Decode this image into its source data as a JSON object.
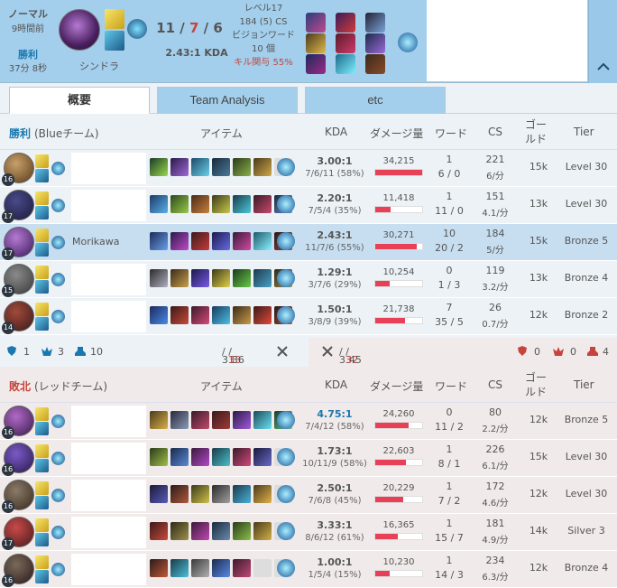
{
  "header": {
    "mode": "ノーマル",
    "time_ago": "9時間前",
    "result": "勝利",
    "length": "37分 8秒",
    "champion": "シンドラ",
    "kills": "11",
    "deaths": "7",
    "assists": "6",
    "sep": "/",
    "kda_ratio": "2.43:1 KDA",
    "level": "レベル17",
    "cs": "184 (5) CS",
    "vision_label": "ビジョンワード",
    "vision_count": "10 個",
    "kill_participation": "キル関与 55%"
  },
  "tabs": [
    {
      "label": "概要"
    },
    {
      "label": "Team Analysis"
    },
    {
      "label": "etc"
    }
  ],
  "columns": {
    "items": "アイテム",
    "kda": "KDA",
    "damage": "ダメージ量",
    "ward": "ワード",
    "cs": "CS",
    "gold": "ゴールド",
    "tier": "Tier"
  },
  "blue": {
    "result": "勝利",
    "team": "(Blueチーム)",
    "players": [
      {
        "lvl": "16",
        "name": "",
        "kda": "3.00:1",
        "kdaf": "7/6/11 (58%)",
        "dmg": "34,215",
        "dmgp": 1.0,
        "w1": "1",
        "w2": "6 / 0",
        "cs1": "221",
        "cs2": "6/分",
        "gold": "15k",
        "tier": "Level 30"
      },
      {
        "lvl": "17",
        "name": "",
        "kda": "2.20:1",
        "kdaf": "7/5/4 (35%)",
        "dmg": "11,418",
        "dmgp": 0.33,
        "w1": "1",
        "w2": "11 / 0",
        "cs1": "151",
        "cs2": "4.1/分",
        "gold": "13k",
        "tier": "Level 30"
      },
      {
        "lvl": "17",
        "name": "Morikawa",
        "kda": "2.43:1",
        "kdaf": "11/7/6 (55%)",
        "dmg": "30,271",
        "dmgp": 0.88,
        "w1": "10",
        "w2": "20 / 2",
        "cs1": "184",
        "cs2": "5/分",
        "gold": "15k",
        "tier": "Bronze 5"
      },
      {
        "lvl": "15",
        "name": "",
        "kda": "1.29:1",
        "kdaf": "3/7/6 (29%)",
        "dmg": "10,254",
        "dmgp": 0.3,
        "w1": "0",
        "w2": "1 / 3",
        "cs1": "119",
        "cs2": "3.2/分",
        "gold": "13k",
        "tier": "Bronze 4"
      },
      {
        "lvl": "14",
        "name": "",
        "kda": "1.50:1",
        "kdaf": "3/8/9 (39%)",
        "dmg": "21,738",
        "dmgp": 0.64,
        "w1": "7",
        "w2": "35 / 5",
        "cs1": "26",
        "cs2": "0.7/分",
        "gold": "12k",
        "tier": "Bronze 2"
      }
    ]
  },
  "summary": {
    "blue_towers": "1",
    "blue_dragons": "3",
    "blue_barons": "10",
    "blue_k": "31",
    "blue_d": "33",
    "blue_a": "36",
    "red_k": "33",
    "red_d": "32",
    "red_a": "45",
    "red_towers": "0",
    "red_dragons": "0",
    "red_barons": "4"
  },
  "red": {
    "result": "敗北",
    "team": "(レッドチーム)",
    "players": [
      {
        "lvl": "16",
        "name": "",
        "kda": "4.75:1",
        "kdaf": "7/4/12 (58%)",
        "dmg": "24,260",
        "dmgp": 0.71,
        "w1": "0",
        "w2": "11 / 2",
        "cs1": "80",
        "cs2": "2.2/分",
        "gold": "12k",
        "tier": "Bronze 5"
      },
      {
        "lvl": "16",
        "name": "",
        "kda": "1.73:1",
        "kdaf": "10/11/9 (58%)",
        "dmg": "22,603",
        "dmgp": 0.66,
        "w1": "1",
        "w2": "8 / 1",
        "cs1": "226",
        "cs2": "6.1/分",
        "gold": "15k",
        "tier": "Level 30"
      },
      {
        "lvl": "16",
        "name": "",
        "kda": "2.50:1",
        "kdaf": "7/6/8 (45%)",
        "dmg": "20,229",
        "dmgp": 0.59,
        "w1": "1",
        "w2": "7 / 2",
        "cs1": "172",
        "cs2": "4.6/分",
        "gold": "12k",
        "tier": "Level 30"
      },
      {
        "lvl": "17",
        "name": "",
        "kda": "3.33:1",
        "kdaf": "8/6/12 (61%)",
        "dmg": "16,365",
        "dmgp": 0.48,
        "w1": "1",
        "w2": "15 / 7",
        "cs1": "181",
        "cs2": "4.9/分",
        "gold": "14k",
        "tier": "Silver 3"
      },
      {
        "lvl": "16",
        "name": "",
        "kda": "1.00:1",
        "kdaf": "1/5/4 (15%)",
        "dmg": "10,230",
        "dmgp": 0.3,
        "w1": "1",
        "w2": "14 / 3",
        "cs1": "234",
        "cs2": "6.3/分",
        "gold": "12k",
        "tier": "Bronze 4"
      }
    ]
  },
  "colors": {
    "accent": "#a3cfec",
    "win_bg": "#ecf2f6",
    "loss_bg": "#f1eaea",
    "highlight": "#c7def0",
    "death": "#c6443e",
    "bar": "#e84057",
    "win_text": "#1a78ae"
  }
}
